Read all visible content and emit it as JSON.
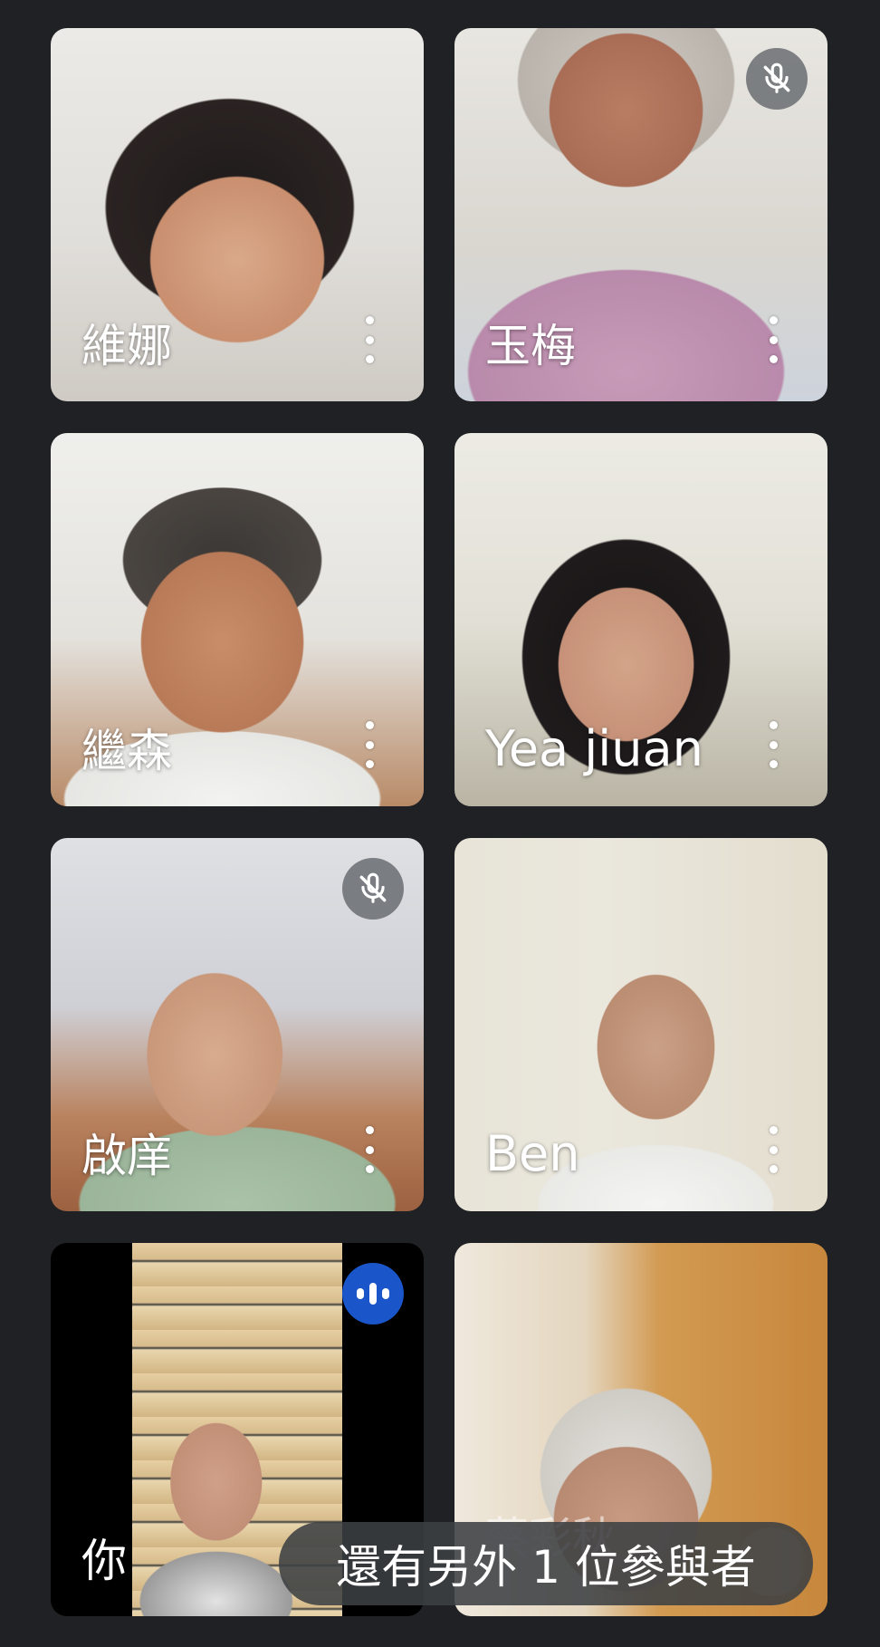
{
  "participants": [
    {
      "name": "維娜",
      "muted": false
    },
    {
      "name": "玉梅",
      "muted": true
    },
    {
      "name": "繼森",
      "muted": false
    },
    {
      "name": "Yea jiuan",
      "muted": false
    },
    {
      "name": "啟庠",
      "muted": true
    },
    {
      "name": "Ben",
      "muted": false
    },
    {
      "name": "你",
      "speaking": true
    },
    {
      "name": "蔡彩秋"
    }
  ],
  "overflow": {
    "label": "還有另外 1 位參與者"
  },
  "colors": {
    "background": "#202124",
    "speaking_indicator": "#1a56c9",
    "muted_indicator": "#5f6368"
  },
  "icons": [
    "mic-off-icon",
    "more-vert-icon",
    "speaking-indicator-icon"
  ]
}
